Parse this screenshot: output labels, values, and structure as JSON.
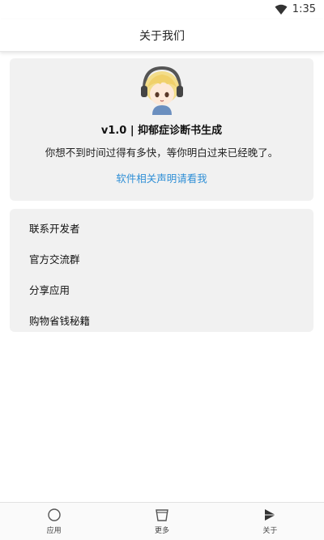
{
  "status_bar": {
    "time": "1:35",
    "signal_icon": "wifi-icon"
  },
  "header": {
    "title": "关于我们"
  },
  "info_card": {
    "avatar_icon": "anime-avatar",
    "app_title": "v1.0 | 抑郁症诊断书生成",
    "description": "你想不到时间过得有多快，等你明白过来已经晚了。",
    "statement_link": "软件相关声明请看我",
    "link_color": "#2f8fd6"
  },
  "menu": {
    "items": [
      {
        "label": "联系开发者"
      },
      {
        "label": "官方交流群"
      },
      {
        "label": "分享应用"
      },
      {
        "label": "购物省钱秘籍"
      }
    ]
  },
  "bottom_nav": {
    "items": [
      {
        "label": "应用",
        "icon": "circle-icon"
      },
      {
        "label": "更多",
        "icon": "cup-icon"
      },
      {
        "label": "关于",
        "icon": "play-triangle-icon"
      }
    ]
  }
}
